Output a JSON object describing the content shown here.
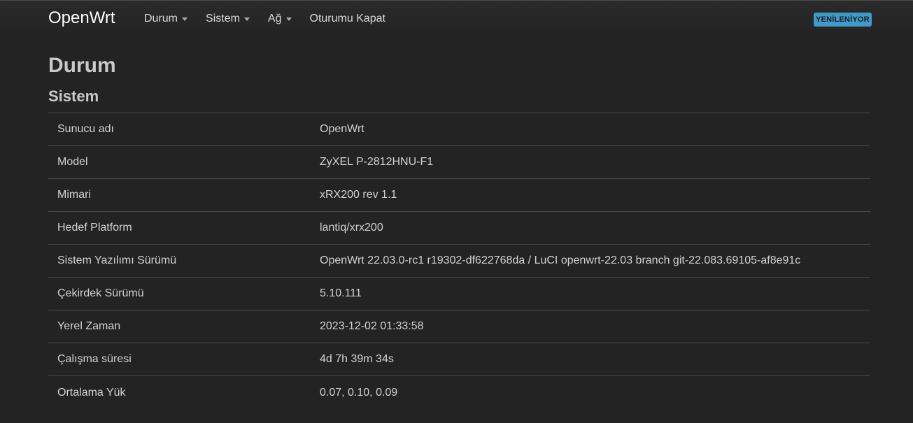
{
  "header": {
    "brand": "OpenWrt",
    "nav": [
      {
        "label": "Durum",
        "has_dropdown": true
      },
      {
        "label": "Sistem",
        "has_dropdown": true
      },
      {
        "label": "Ağ",
        "has_dropdown": true
      },
      {
        "label": "Oturumu Kapat",
        "has_dropdown": false
      }
    ],
    "status_badge": "YENİLENİYOR",
    "badge_color": "#3c9bc9"
  },
  "page": {
    "title": "Durum",
    "section_title": "Sistem"
  },
  "system_table": [
    {
      "key": "Sunucu adı",
      "value": "OpenWrt"
    },
    {
      "key": "Model",
      "value": "ZyXEL P-2812HNU-F1"
    },
    {
      "key": "Mimari",
      "value": "xRX200 rev 1.1"
    },
    {
      "key": "Hedef Platform",
      "value": "lantiq/xrx200"
    },
    {
      "key": "Sistem Yazılımı Sürümü",
      "value": "OpenWrt 22.03.0-rc1 r19302-df622768da / LuCI openwrt-22.03 branch git-22.083.69105-af8e91c"
    },
    {
      "key": "Çekirdek Sürümü",
      "value": "5.10.111"
    },
    {
      "key": "Yerel Zaman",
      "value": "2023-12-02 01:33:58"
    },
    {
      "key": "Çalışma süresi",
      "value": "4d 7h 39m 34s"
    },
    {
      "key": "Ortalama Yük",
      "value": "0.07, 0.10, 0.09"
    }
  ]
}
